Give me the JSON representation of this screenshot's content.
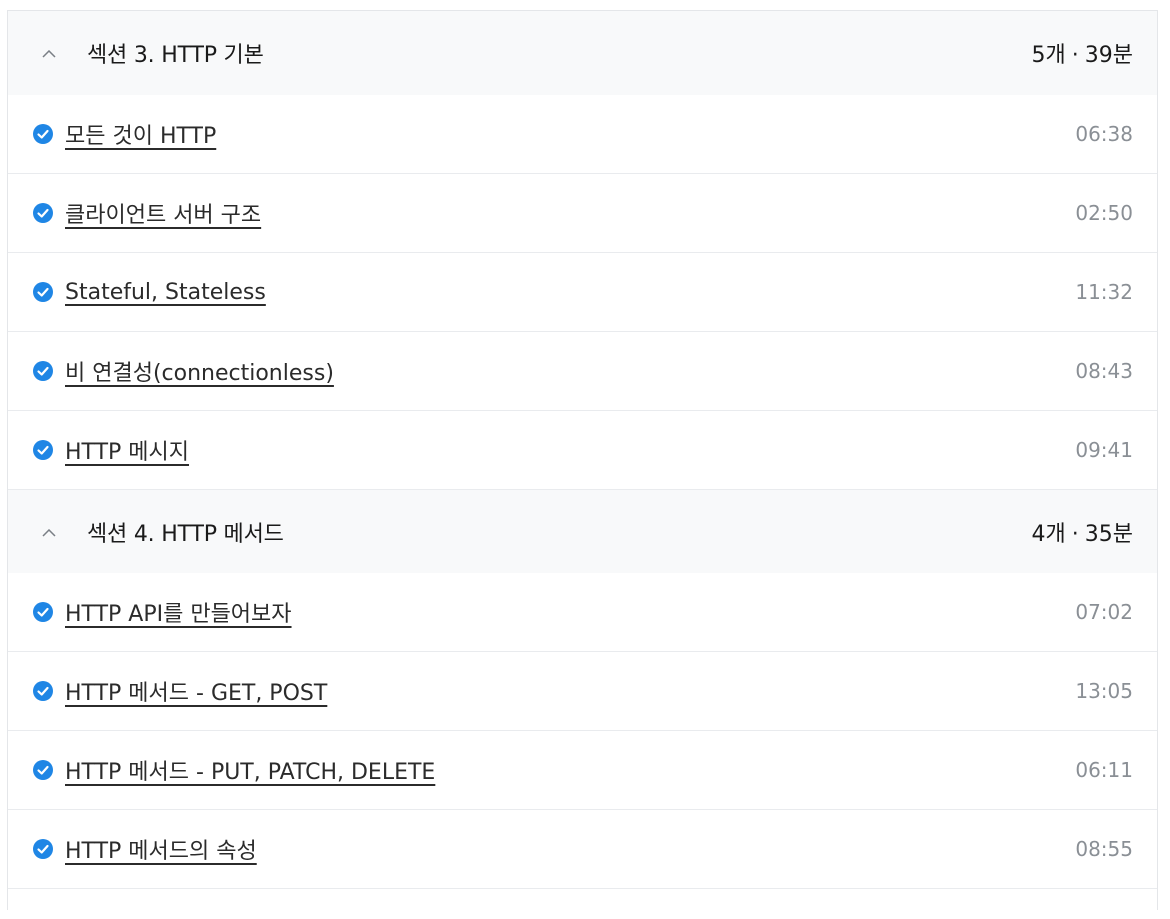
{
  "colors": {
    "check_blue": "#1f86e5",
    "section_bg": "#f8f9fa",
    "time_gray": "#8a8f95"
  },
  "sections": [
    {
      "title": "섹션 3. HTTP 기본",
      "count": "5개",
      "separator": "·",
      "duration": "39분",
      "lectures": [
        {
          "title": "모든 것이 HTTP",
          "time": "06:38",
          "completed": true
        },
        {
          "title": "클라이언트 서버 구조",
          "time": "02:50",
          "completed": true
        },
        {
          "title": "Stateful, Stateless",
          "time": "11:32",
          "completed": true
        },
        {
          "title": "비 연결성(connectionless)",
          "time": "08:43",
          "completed": true
        },
        {
          "title": "HTTP 메시지",
          "time": "09:41",
          "completed": true
        }
      ]
    },
    {
      "title": "섹션 4. HTTP 메서드",
      "count": "4개",
      "separator": "·",
      "duration": "35분",
      "lectures": [
        {
          "title": "HTTP API를 만들어보자",
          "time": "07:02",
          "completed": true
        },
        {
          "title": "HTTP 메서드 - GET, POST",
          "time": "13:05",
          "completed": true
        },
        {
          "title": "HTTP 메서드 - PUT, PATCH, DELETE",
          "time": "06:11",
          "completed": true
        },
        {
          "title": "HTTP 메서드의 속성",
          "time": "08:55",
          "completed": true
        }
      ]
    }
  ]
}
